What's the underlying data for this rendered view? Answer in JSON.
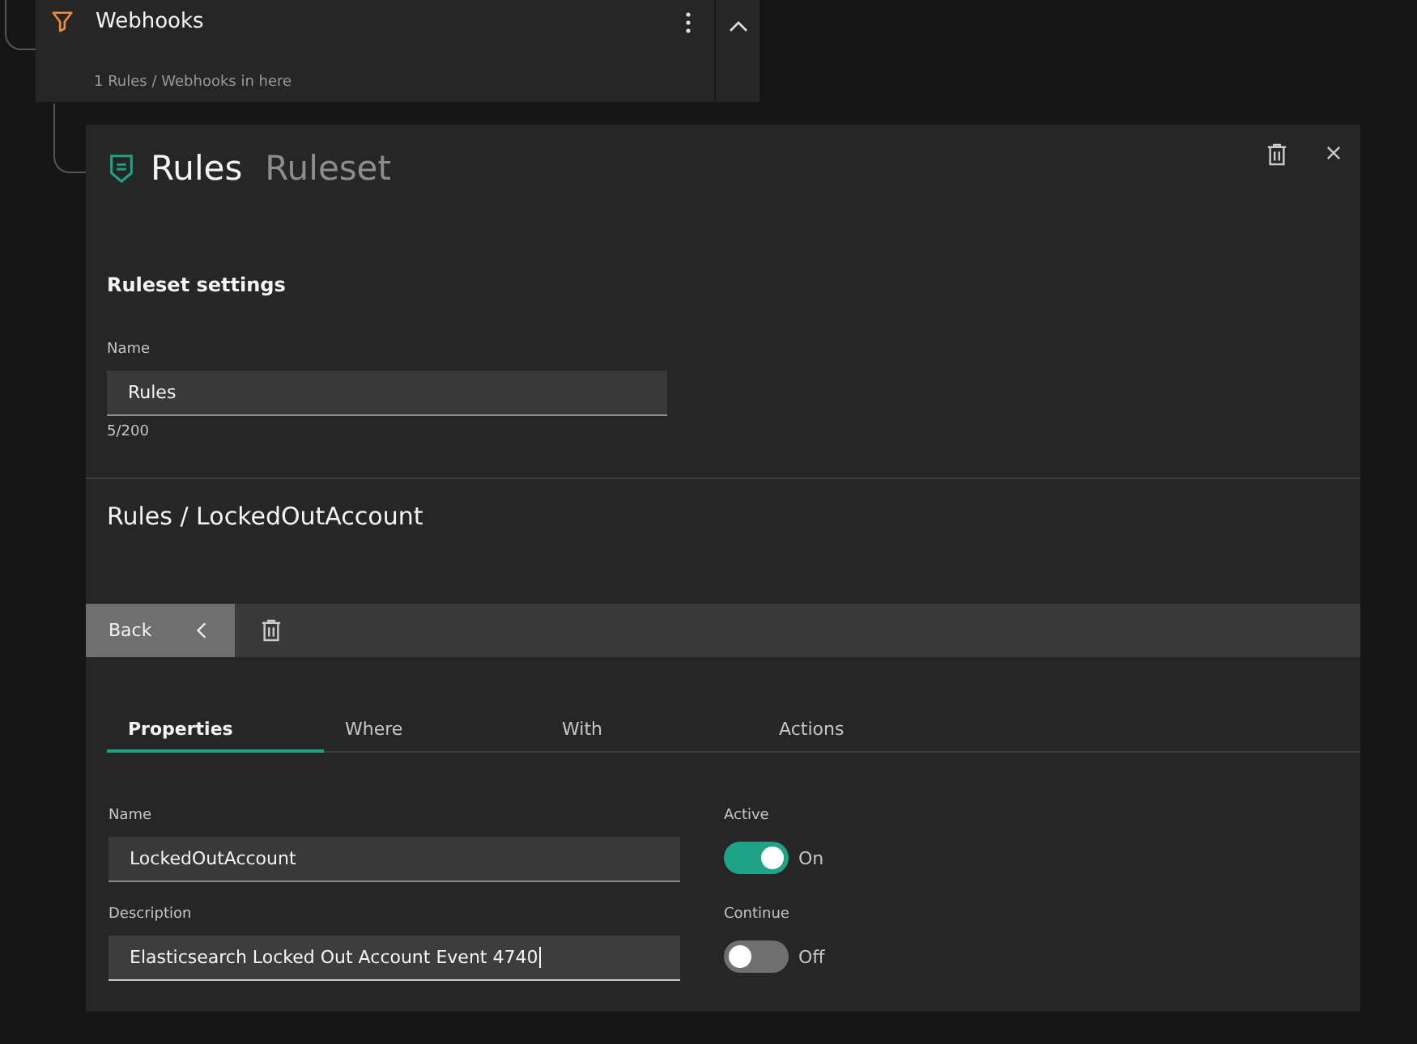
{
  "group_card": {
    "title": "Webhooks",
    "subtitle": "1 Rules / Webhooks in here",
    "expanded": true
  },
  "panel": {
    "title": "Rules",
    "subtitle": "Ruleset",
    "settings": {
      "heading": "Ruleset settings",
      "name_label": "Name",
      "name_value": "Rules",
      "counter": "5/200"
    },
    "breadcrumb": "Rules / LockedOutAccount",
    "toolbar": {
      "back_label": "Back"
    },
    "tabs": [
      {
        "label": "Properties",
        "selected": true
      },
      {
        "label": "Where",
        "selected": false
      },
      {
        "label": "With",
        "selected": false
      },
      {
        "label": "Actions",
        "selected": false
      }
    ],
    "rows": [
      {
        "field": {
          "label": "Name",
          "value": "LockedOutAccount",
          "focused": false
        },
        "toggle": {
          "label": "Active",
          "on": true,
          "state_label": "On"
        }
      },
      {
        "field": {
          "label": "Description",
          "value": "Elasticsearch Locked Out Account Event 4740",
          "focused": true
        },
        "toggle": {
          "label": "Continue",
          "on": false,
          "state_label": "Off"
        }
      }
    ]
  }
}
